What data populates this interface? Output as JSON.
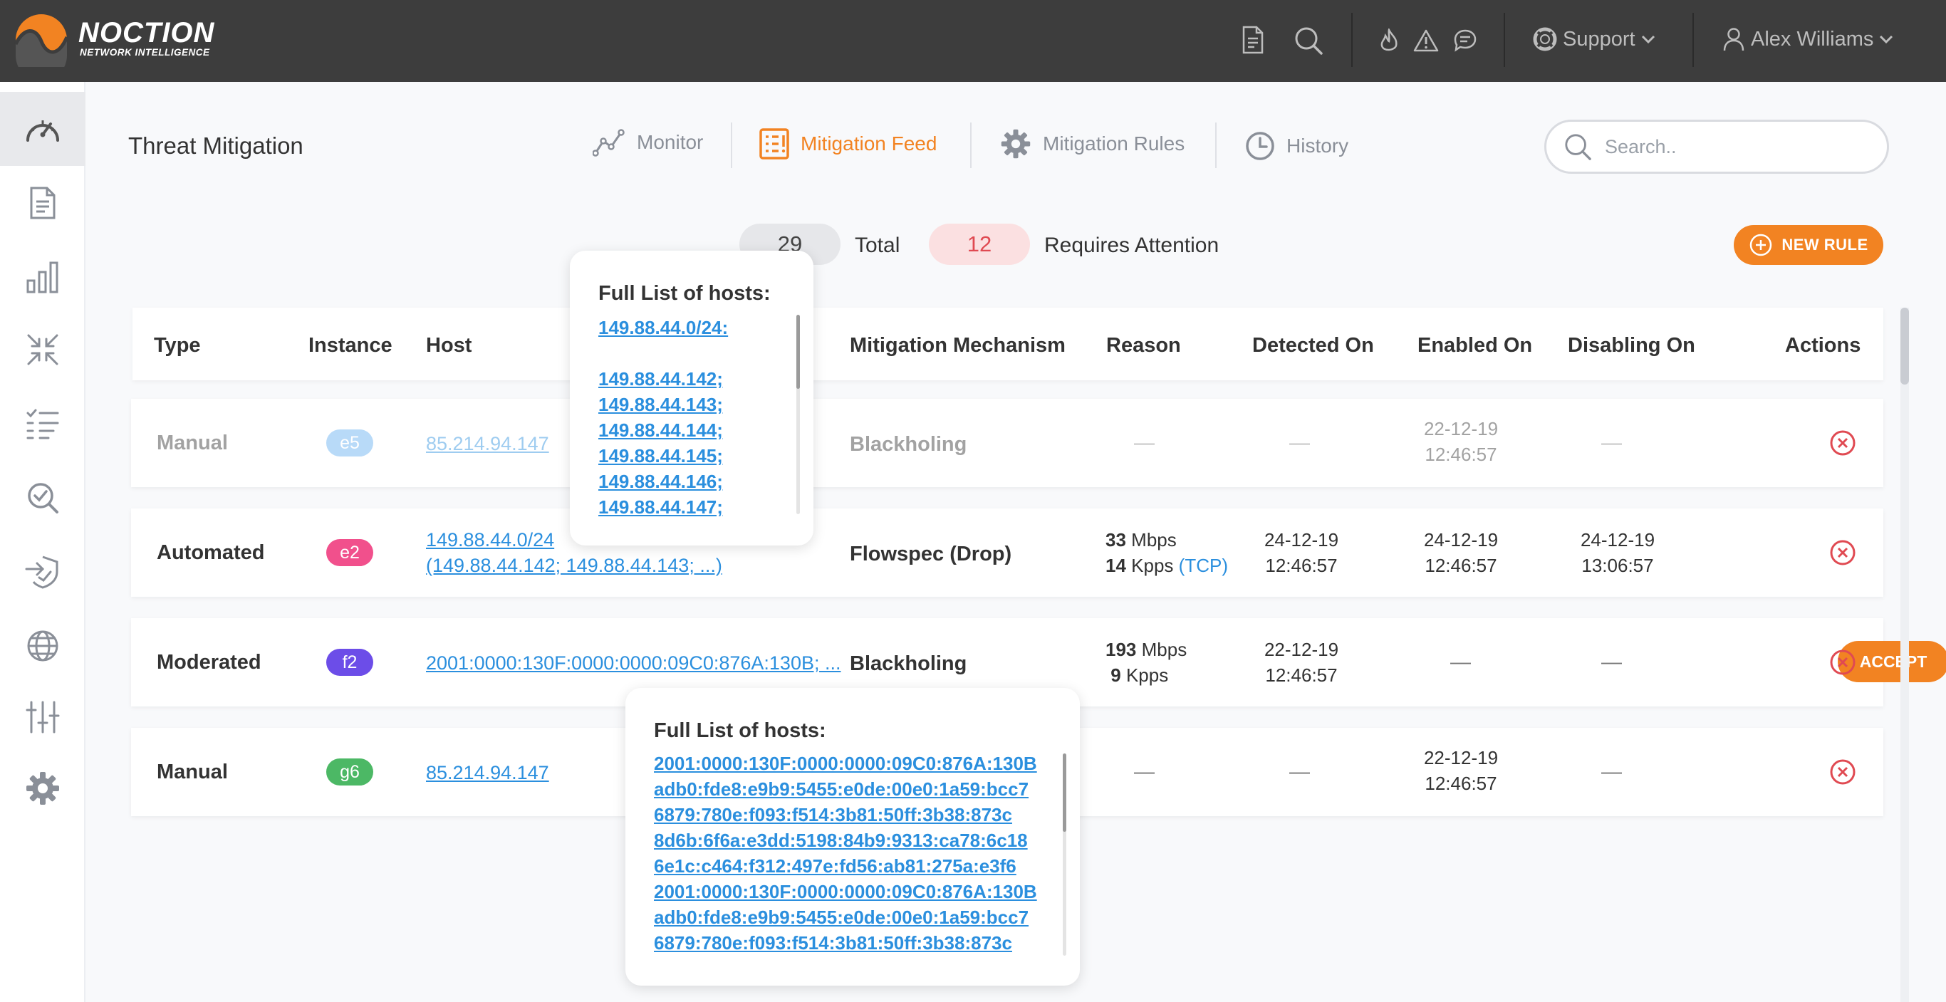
{
  "app": {
    "brand": "NOCTION",
    "tagline": "NETWORK INTELLIGENCE"
  },
  "topbar": {
    "support_label": "Support",
    "user_name": "Alex Williams"
  },
  "header": {
    "title": "Threat Mitigation",
    "tabs": [
      {
        "label": "Monitor",
        "icon": "line-chart-icon"
      },
      {
        "label": "Mitigation Feed",
        "icon": "feed-list-icon",
        "active": true
      },
      {
        "label": "Mitigation Rules",
        "icon": "gear-icon"
      },
      {
        "label": "History",
        "icon": "clock-icon"
      }
    ],
    "search_placeholder": "Search.."
  },
  "summary": {
    "total_count": "29",
    "total_label": "Total",
    "attention_count": "12",
    "attention_label": "Requires Attention",
    "new_rule_label": "NEW RULE"
  },
  "table": {
    "columns": [
      "Type",
      "Instance",
      "Host",
      "Mitigation Mechanism",
      "Reason",
      "Detected On",
      "Enabled On",
      "Disabling On",
      "Actions"
    ],
    "rows": [
      {
        "type": "Manual",
        "instance": "e5",
        "instance_color": "#64aef0",
        "host": "85.214.94.147",
        "mechanism": "Blackholing",
        "reason": "—",
        "detected": "—",
        "enabled_date": "22-12-19",
        "enabled_time": "12:46:57",
        "disabling": "—",
        "faded": true
      },
      {
        "type": "Automated",
        "instance": "e2",
        "instance_color": "#f1508c",
        "host_line1": "149.88.44.0/24",
        "host_line2": "(149.88.44.142; 149.88.44.143; ...)",
        "mechanism": "Flowspec (Drop)",
        "reason_mbps_value": "33",
        "reason_mbps_unit": "Mbps",
        "reason_kpps_value": "14",
        "reason_kpps_unit": "Kpps",
        "reason_proto": "(TCP)",
        "detected_date": "24-12-19",
        "detected_time": "12:46:57",
        "enabled_date": "24-12-19",
        "enabled_time": "12:46:57",
        "disabling_date": "24-12-19",
        "disabling_time": "13:06:57"
      },
      {
        "type": "Moderated",
        "instance": "f2",
        "instance_color": "#6c4de8",
        "host": "2001:0000:130F:0000:0000:09C0:876A:130B; ...",
        "mechanism": "Blackholing",
        "reason_mbps_value": "193",
        "reason_mbps_unit": "Mbps",
        "reason_kpps_value": "9",
        "reason_kpps_unit": "Kpps",
        "detected_date": "22-12-19",
        "detected_time": "12:46:57",
        "enabled": "—",
        "disabling": "—",
        "accept_label": "ACCEPT"
      },
      {
        "type": "Manual",
        "instance": "g6",
        "instance_color": "#4cb865",
        "host": "85.214.94.147",
        "reason": "—",
        "detected": "—",
        "enabled_date": "22-12-19",
        "enabled_time": "12:46:57",
        "disabling": "—"
      }
    ]
  },
  "popover_ipv4": {
    "title": "Full List of hosts:",
    "hosts": [
      "149.88.44.0/24:",
      "",
      "149.88.44.142;",
      "149.88.44.143;",
      "149.88.44.144;",
      "149.88.44.145;",
      "149.88.44.146;",
      "149.88.44.147;"
    ]
  },
  "popover_ipv6": {
    "title": "Full List of hosts:",
    "hosts": [
      "2001:0000:130F:0000:0000:09C0:876A:130B",
      "adb0:fde8:e9b9:5455:e0de:00e0:1a59:bcc7",
      "6879:780e:f093:f514:3b81:50ff:3b38:873c",
      "8d6b:6f6a:e3dd:5198:84b9:9313:ca78:6c18",
      "6e1c:c464:f312:497e:fd56:ab81:275a:e3f6",
      "2001:0000:130F:0000:0000:09C0:876A:130B",
      "adb0:fde8:e9b9:5455:e0de:00e0:1a59:bcc7",
      "6879:780e:f093:f514:3b81:50ff:3b38:873c"
    ]
  },
  "colors": {
    "accent": "#f28322",
    "link": "#2b8fde",
    "danger": "#e04a52"
  }
}
